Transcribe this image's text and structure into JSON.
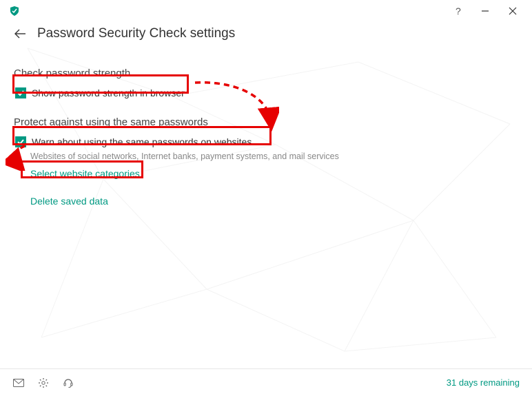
{
  "window": {
    "title": "Password Security Check settings"
  },
  "sections": {
    "strength": {
      "heading": "Check password strength",
      "checkbox_label": "Show password strength in browser"
    },
    "reuse": {
      "heading": "Protect against using the same passwords",
      "checkbox_label": "Warn about using the same passwords on websites",
      "subtext": "Websites of social networks, Internet banks, payment systems, and mail services",
      "select_link": "Select website categories"
    },
    "delete_link": "Delete saved data"
  },
  "status": {
    "remaining": "31 days remaining"
  }
}
